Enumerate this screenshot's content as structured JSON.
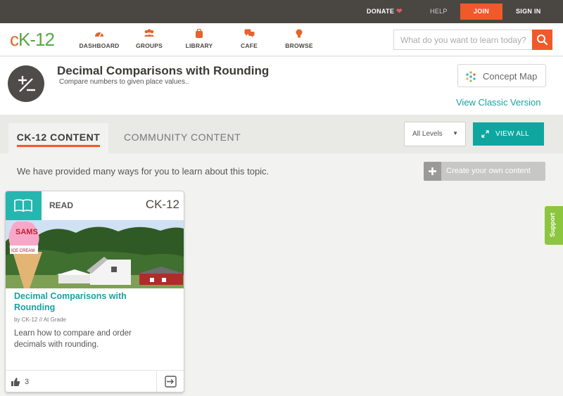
{
  "topbar": {
    "donate": "DONATE",
    "help": "HELP",
    "join": "JOIN",
    "signin": "SIGN IN"
  },
  "logo": {
    "c": "c",
    "k": "K",
    "rest": "-12"
  },
  "nav": [
    {
      "label": "DASHBOARD",
      "icon": "dashboard-icon"
    },
    {
      "label": "GROUPS",
      "icon": "groups-icon"
    },
    {
      "label": "LIBRARY",
      "icon": "library-icon"
    },
    {
      "label": "CAFE",
      "icon": "cafe-icon"
    },
    {
      "label": "BROWSE",
      "icon": "browse-icon"
    }
  ],
  "search": {
    "placeholder": "What do you want to learn today?",
    "icon": "search-icon"
  },
  "concept": {
    "title": "Decimal Comparisons with Rounding",
    "subtitle": "Compare numbers to given place values..",
    "icon": "plus-minus-icon"
  },
  "concept_map": {
    "label": "Concept Map",
    "icon": "concept-map-icon"
  },
  "view_classic": "View Classic Version",
  "tabs": [
    {
      "label": "CK-12 CONTENT",
      "active": true
    },
    {
      "label": "COMMUNITY CONTENT",
      "active": false
    }
  ],
  "levels": {
    "selected": "All Levels"
  },
  "view_all": {
    "label": "VIEW ALL",
    "icon": "expand-icon"
  },
  "intro": "We have provided many ways for you to learn about this topic.",
  "create_button": {
    "label": "Create your own content",
    "icon": "plus-icon"
  },
  "card": {
    "type": "READ",
    "type_icon": "book-icon",
    "brand": "CK-12",
    "title": "Decimal Comparisons with Rounding",
    "author": "by CK-12",
    "level": "// At Grade",
    "description": "Learn how to compare and order decimals with rounding.",
    "likes": "3",
    "image_sign": "SAMS",
    "image_sign2": "ICE CREAM"
  },
  "support": "Support",
  "colors": {
    "accent_orange": "#f05a2a",
    "teal": "#0fa6a0",
    "support_green": "#8cc63f",
    "dark": "#4a4743"
  }
}
